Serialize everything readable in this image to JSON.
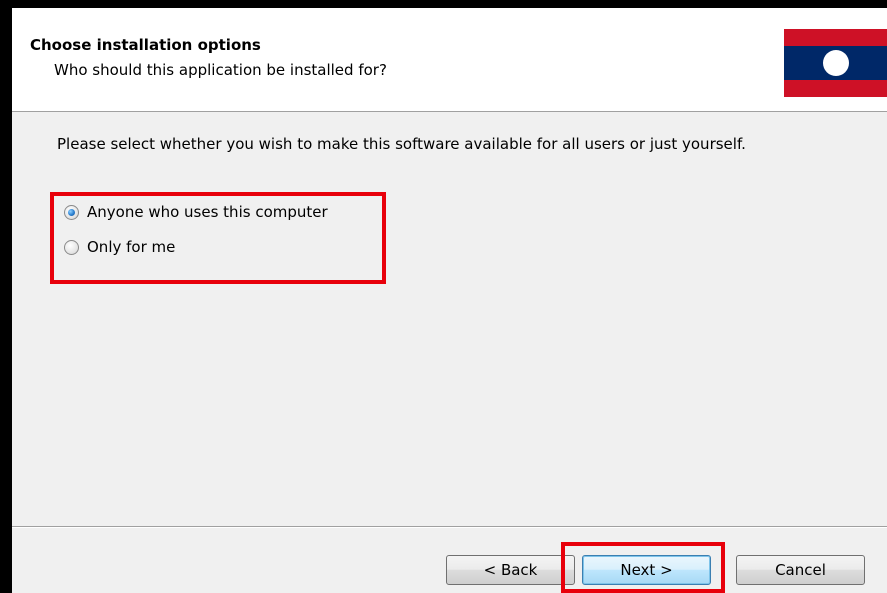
{
  "header": {
    "title": "Choose installation options",
    "subtitle": "Who should this application be installed for?",
    "flag_icon": "laos-flag-icon",
    "flag_colors": {
      "stripe": "#ce1126",
      "band": "#002868",
      "disc": "#ffffff"
    }
  },
  "body": {
    "description": "Please select whether you wish to make this software available for all users or just yourself.",
    "options": [
      {
        "label": "Anyone who uses this computer",
        "selected": true
      },
      {
        "label": "Only for me",
        "selected": false
      }
    ]
  },
  "footer": {
    "back_label": "< Back",
    "next_label": "Next >",
    "cancel_label": "Cancel"
  },
  "colors": {
    "highlight": "#e8000b",
    "dialog_background": "#f0f0f0"
  }
}
